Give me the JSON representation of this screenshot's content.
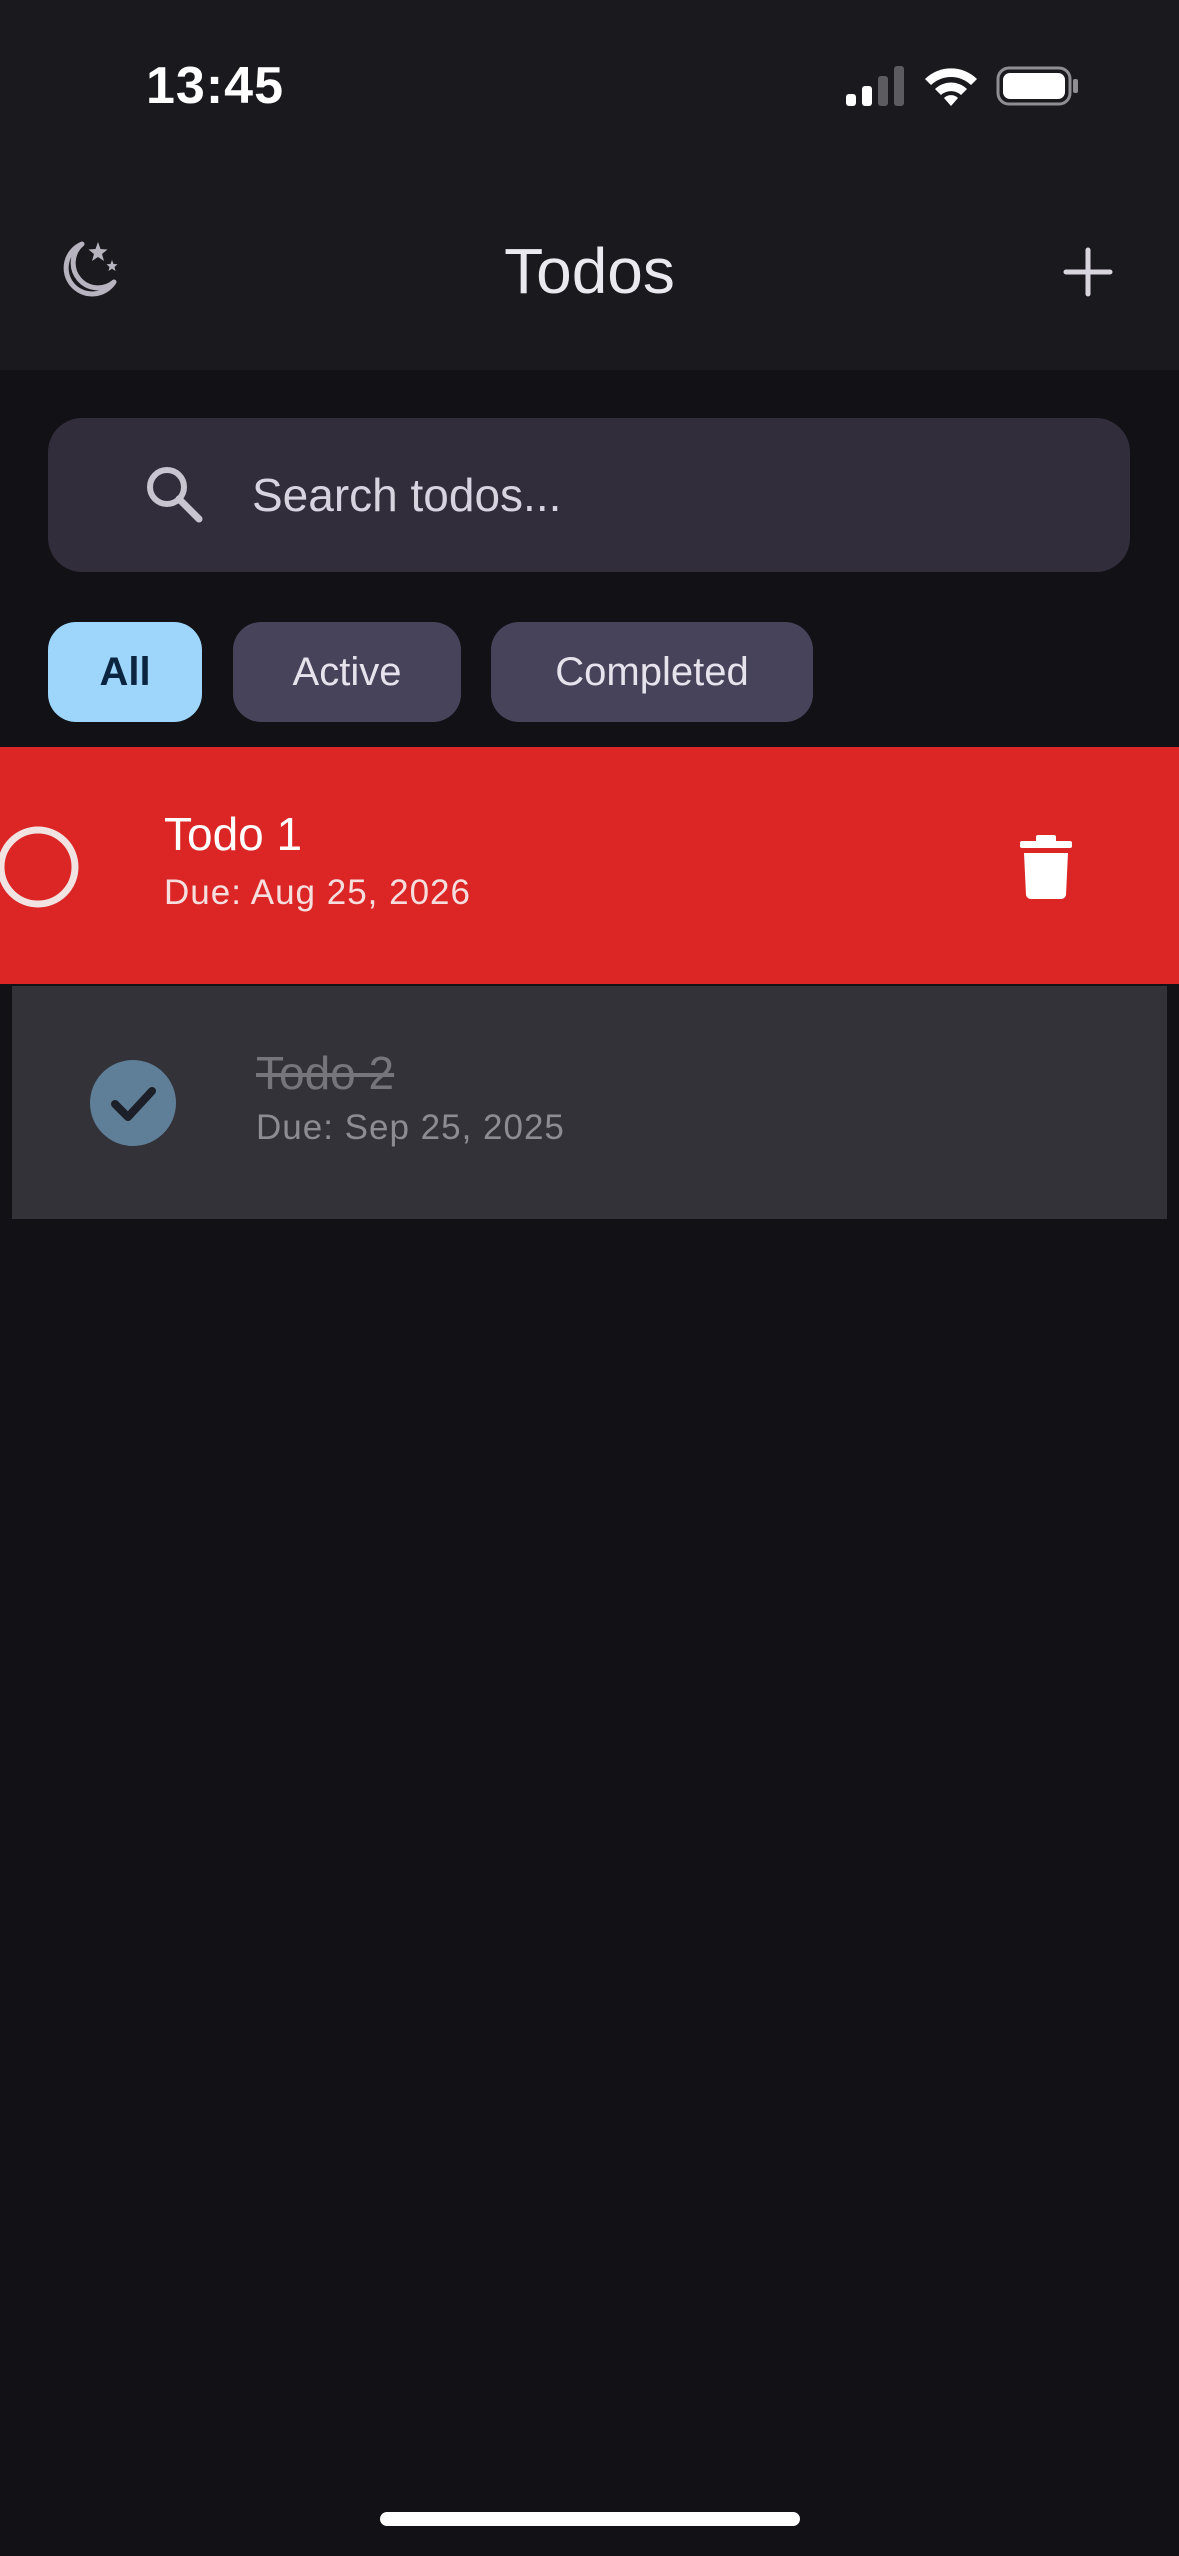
{
  "status_bar": {
    "time": "13:45"
  },
  "header": {
    "title": "Todos",
    "theme_icon": "moon-stars-icon",
    "add_icon": "plus-icon"
  },
  "search": {
    "placeholder": "Search todos...",
    "value": ""
  },
  "filters": {
    "selected": "All",
    "items": [
      "All",
      "Active",
      "Completed"
    ]
  },
  "todos": [
    {
      "title": "Todo 1",
      "due": "Due: Aug 25, 2026",
      "completed": false,
      "swipe_action": "delete"
    },
    {
      "title": "Todo 2",
      "due": "Due: Sep 25, 2025",
      "completed": true
    }
  ],
  "colors": {
    "background": "#111116",
    "header": "#1a1a1e",
    "selected_chip": "#9dd6fa",
    "chip": "#47435a",
    "delete_swipe": "#dc2626",
    "completed_check": "#5f7f99"
  }
}
